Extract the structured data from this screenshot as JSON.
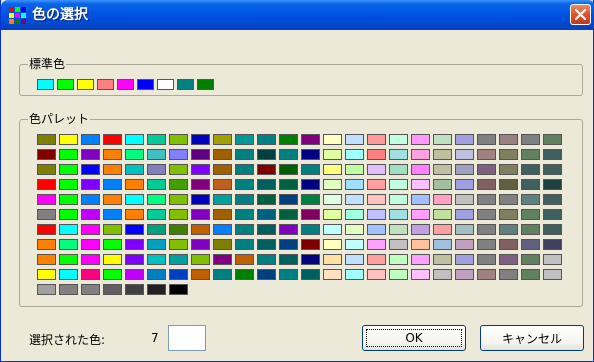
{
  "window": {
    "title": "色の選択"
  },
  "standard": {
    "label": "標準色",
    "colors": [
      "#00ffff",
      "#00ff00",
      "#ffff00",
      "#ff8080",
      "#ff00ff",
      "#0000ff",
      "#ffffff",
      "#008080",
      "#008000"
    ]
  },
  "palette": {
    "label": "色パレット",
    "colors": [
      [
        "#808000",
        "#ffff00",
        "#0080ff",
        "#ff0000",
        "#00ffff",
        "#00cc99",
        "#80c000",
        "#0000c0",
        "#a0a000",
        "#009999",
        "#008080",
        "#008000",
        "#800080",
        "#ffffc0",
        "#c0e0ff",
        "#ff9999",
        "#c0ffe0",
        "#ff99ff",
        "#c0e0c0",
        "#a0a0e0",
        "#808080",
        "#998080",
        "#808080",
        "#608060"
      ],
      [
        "#800000",
        "#00ff00",
        "#8000c0",
        "#ff8000",
        "#00ff80",
        "#40c0c0",
        "#8080ff",
        "#600080",
        "#a06000",
        "#008080",
        "#004040",
        "#008080",
        "#000080",
        "#e0ffa0",
        "#a0ffff",
        "#ff8080",
        "#a0e0e0",
        "#ffa0e0",
        "#c0c0a0",
        "#c0c0e0",
        "#a08080",
        "#808060",
        "#608060",
        "#406060"
      ],
      [
        "#808000",
        "#00ff00",
        "#0000ff",
        "#ff8000",
        "#00c0c0",
        "#8080c0",
        "#80c000",
        "#8000ff",
        "#a06000",
        "#008080",
        "#800000",
        "#006000",
        "#008080",
        "#ffff80",
        "#c0ffa0",
        "#e0c0ff",
        "#a0e0c0",
        "#ff80ff",
        "#c0c0a0",
        "#a0a0c0",
        "#806080",
        "#808060",
        "#406060",
        "#406060"
      ],
      [
        "#ff0000",
        "#00ff00",
        "#8000ff",
        "#0080ff",
        "#ff8000",
        "#00cc99",
        "#40a000",
        "#800080",
        "#c06020",
        "#008080",
        "#006060",
        "#006040",
        "#000080",
        "#e0ffc0",
        "#a0e0ff",
        "#ffa0a0",
        "#c0ffe0",
        "#ffc0ff",
        "#a0c0a0",
        "#a0a0e0",
        "#806060",
        "#606040",
        "#406060",
        "#204040"
      ],
      [
        "#ff00ff",
        "#00ff00",
        "#0080ff",
        "#ff8000",
        "#00ffff",
        "#00ff80",
        "#80c000",
        "#0000c0",
        "#00a0a0",
        "#008080",
        "#006040",
        "#004080",
        "#008040",
        "#e0ffe0",
        "#c0e0ff",
        "#ffc0c0",
        "#c0ffe0",
        "#a0c0ff",
        "#ffa0c0",
        "#c0c0c0",
        "#808080",
        "#808080",
        "#608080",
        "#406060"
      ],
      [
        "#808080",
        "#00ff00",
        "#c000ff",
        "#0080ff",
        "#ff8000",
        "#00cc99",
        "#80c000",
        "#8000c0",
        "#a06000",
        "#008080",
        "#006080",
        "#006040",
        "#800060",
        "#e0ffa0",
        "#a0ffe0",
        "#c0c0ff",
        "#a0e0e0",
        "#ffa0ff",
        "#c0e0a0",
        "#a0a0e0",
        "#808080",
        "#808060",
        "#608060",
        "#406060"
      ],
      [
        "#ff0000",
        "#00ffff",
        "#ff00ff",
        "#80c000",
        "#0000ff",
        "#00a080",
        "#408000",
        "#c06000",
        "#0080ff",
        "#008080",
        "#006060",
        "#8000c0",
        "#008080",
        "#c0ffff",
        "#e0ffc0",
        "#a0c0ff",
        "#c0e0c0",
        "#c0a0e0",
        "#ffa0a0",
        "#a0c0c0",
        "#808080",
        "#608080",
        "#608060",
        "#406060"
      ],
      [
        "#ff8000",
        "#00ff80",
        "#ff00ff",
        "#00ff00",
        "#8000ff",
        "#00a0c0",
        "#80c000",
        "#8000c0",
        "#808000",
        "#008080",
        "#006060",
        "#004080",
        "#800000",
        "#ffffc0",
        "#c0ffff",
        "#ffa0ff",
        "#c0c0c0",
        "#ffc0a0",
        "#a0c0e0",
        "#c0a0c0",
        "#808080",
        "#806060",
        "#606080",
        "#404060"
      ],
      [
        "#ff8000",
        "#00ff00",
        "#ff00ff",
        "#ffff00",
        "#8000ff",
        "#00c0c0",
        "#00a0a0",
        "#80c000",
        "#800080",
        "#c06000",
        "#008080",
        "#006060",
        "#000080",
        "#ffe0a0",
        "#c0e0ff",
        "#ffa0a0",
        "#c0ffc0",
        "#ffa0ff",
        "#c0c0a0",
        "#a0a0e0",
        "#808080",
        "#806080",
        "#608060",
        "#c0c0c0"
      ],
      [
        "#ffff00",
        "#00ffff",
        "#ff0080",
        "#00ff00",
        "#c000ff",
        "#0080c0",
        "#0040c0",
        "#c06000",
        "#008080",
        "#008000",
        "#004080",
        "#008080",
        "#006060",
        "#ffe0c0",
        "#a0ffff",
        "#ffc0c0",
        "#c0ffc0",
        "#ffc0ff",
        "#c0c0c0",
        "#c0a0c0",
        "#a08080",
        "#808080",
        "#608060",
        "#c0c0c0"
      ],
      [
        "#a0a0a0",
        "#808080",
        "#808080",
        "#606060",
        "#404040",
        "#202020",
        "#000000"
      ]
    ]
  },
  "footer": {
    "selected_label": "選択された色:",
    "selected_count": "7",
    "selected_color": "#ffffff"
  },
  "buttons": {
    "ok": "OK",
    "cancel": "キャンセル"
  },
  "icons": {
    "app": "palette-icon",
    "close": "close-icon"
  },
  "theme": {
    "accent": "#0054e3",
    "close": "#d8552f",
    "bg": "#ece9d8"
  }
}
